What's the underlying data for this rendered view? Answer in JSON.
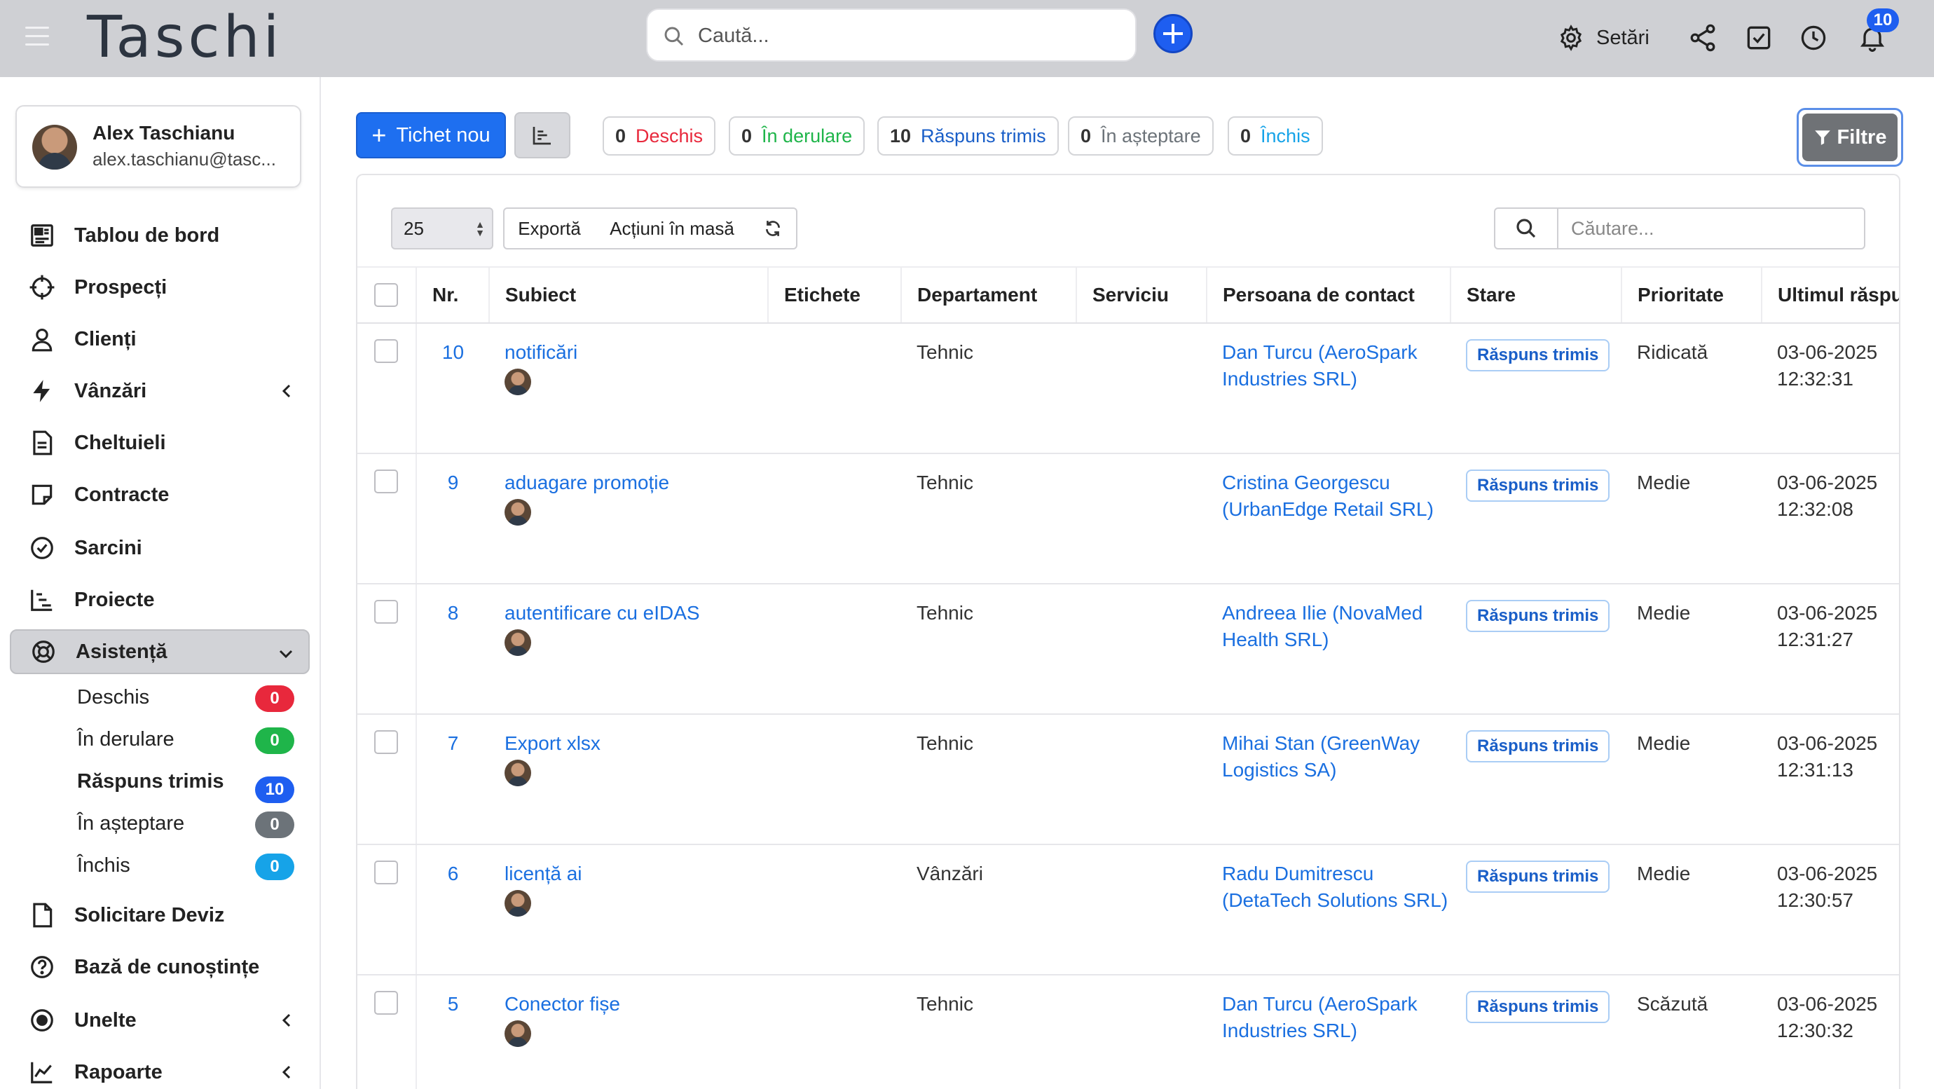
{
  "header": {
    "logo": "Taschi",
    "search_placeholder": "Caută...",
    "settings_label": "Setări",
    "notification_count": "10"
  },
  "user": {
    "name": "Alex Taschianu",
    "email": "alex.taschianu@tasc..."
  },
  "nav": {
    "dashboard": "Tablou de bord",
    "prospects": "Prospecți",
    "clients": "Clienți",
    "sales": "Vânzări",
    "expenses": "Cheltuieli",
    "contracts": "Contracte",
    "tasks": "Sarcini",
    "projects": "Proiecte",
    "support": "Asistență",
    "quote": "Solicitare Deviz",
    "knowledge": "Bază de cunoștințe",
    "tools": "Unelte",
    "reports": "Rapoarte"
  },
  "support_sub": [
    {
      "label": "Deschis",
      "count": "0",
      "color": "#e8283c"
    },
    {
      "label": "În derulare",
      "count": "0",
      "color": "#1fb54a"
    },
    {
      "label": "Răspuns trimis",
      "count": "10",
      "color": "#1e5ef0"
    },
    {
      "label": "În așteptare",
      "count": "0",
      "color": "#6c7379"
    },
    {
      "label": "Închis",
      "count": "0",
      "color": "#16a3e8"
    }
  ],
  "toolbar": {
    "new_ticket": "Tichet nou",
    "filters": "Filtre",
    "page_size": "25",
    "export": "Exportă",
    "bulk_actions": "Acțiuni în masă",
    "search_placeholder": "Căutare..."
  },
  "status_pills": [
    {
      "count": "0",
      "label": "Deschis",
      "color": "#e8283c"
    },
    {
      "count": "0",
      "label": "În derulare",
      "color": "#1fb54a"
    },
    {
      "count": "10",
      "label": "Răspuns trimis",
      "color": "#1a5fc8"
    },
    {
      "count": "0",
      "label": "În așteptare",
      "color": "#6c7379"
    },
    {
      "count": "0",
      "label": "Închis",
      "color": "#16a3e8"
    }
  ],
  "table": {
    "columns": [
      "Nr.",
      "Subiect",
      "Etichete",
      "Departament",
      "Serviciu",
      "Persoana de contact",
      "Stare",
      "Prioritate",
      "Ultimul răspuns"
    ],
    "rows": [
      {
        "nr": "10",
        "subject": "notificări",
        "dept": "Tehnic",
        "contact": "Dan Turcu (AeroSpark Industries SRL)",
        "status": "Răspuns trimis",
        "priority": "Ridicată",
        "date": "03-06-2025",
        "time": "12:32:31"
      },
      {
        "nr": "9",
        "subject": "aduagare promoție",
        "dept": "Tehnic",
        "contact": "Cristina Georgescu (UrbanEdge Retail SRL)",
        "status": "Răspuns trimis",
        "priority": "Medie",
        "date": "03-06-2025",
        "time": "12:32:08"
      },
      {
        "nr": "8",
        "subject": "autentificare cu eIDAS",
        "dept": "Tehnic",
        "contact": "Andreea Ilie (NovaMed Health SRL)",
        "status": "Răspuns trimis",
        "priority": "Medie",
        "date": "03-06-2025",
        "time": "12:31:27"
      },
      {
        "nr": "7",
        "subject": "Export xlsx",
        "dept": "Tehnic",
        "contact": "Mihai Stan (GreenWay Logistics SA)",
        "status": "Răspuns trimis",
        "priority": "Medie",
        "date": "03-06-2025",
        "time": "12:31:13"
      },
      {
        "nr": "6",
        "subject": "licență ai",
        "dept": "Vânzări",
        "contact": "Radu Dumitrescu (DetaTech Solutions SRL)",
        "status": "Răspuns trimis",
        "priority": "Medie",
        "date": "03-06-2025",
        "time": "12:30:57"
      },
      {
        "nr": "5",
        "subject": "Conector fișe",
        "dept": "Tehnic",
        "contact": "Dan Turcu (AeroSpark Industries SRL)",
        "status": "Răspuns trimis",
        "priority": "Scăzută",
        "date": "03-06-2025",
        "time": "12:30:32"
      }
    ]
  }
}
